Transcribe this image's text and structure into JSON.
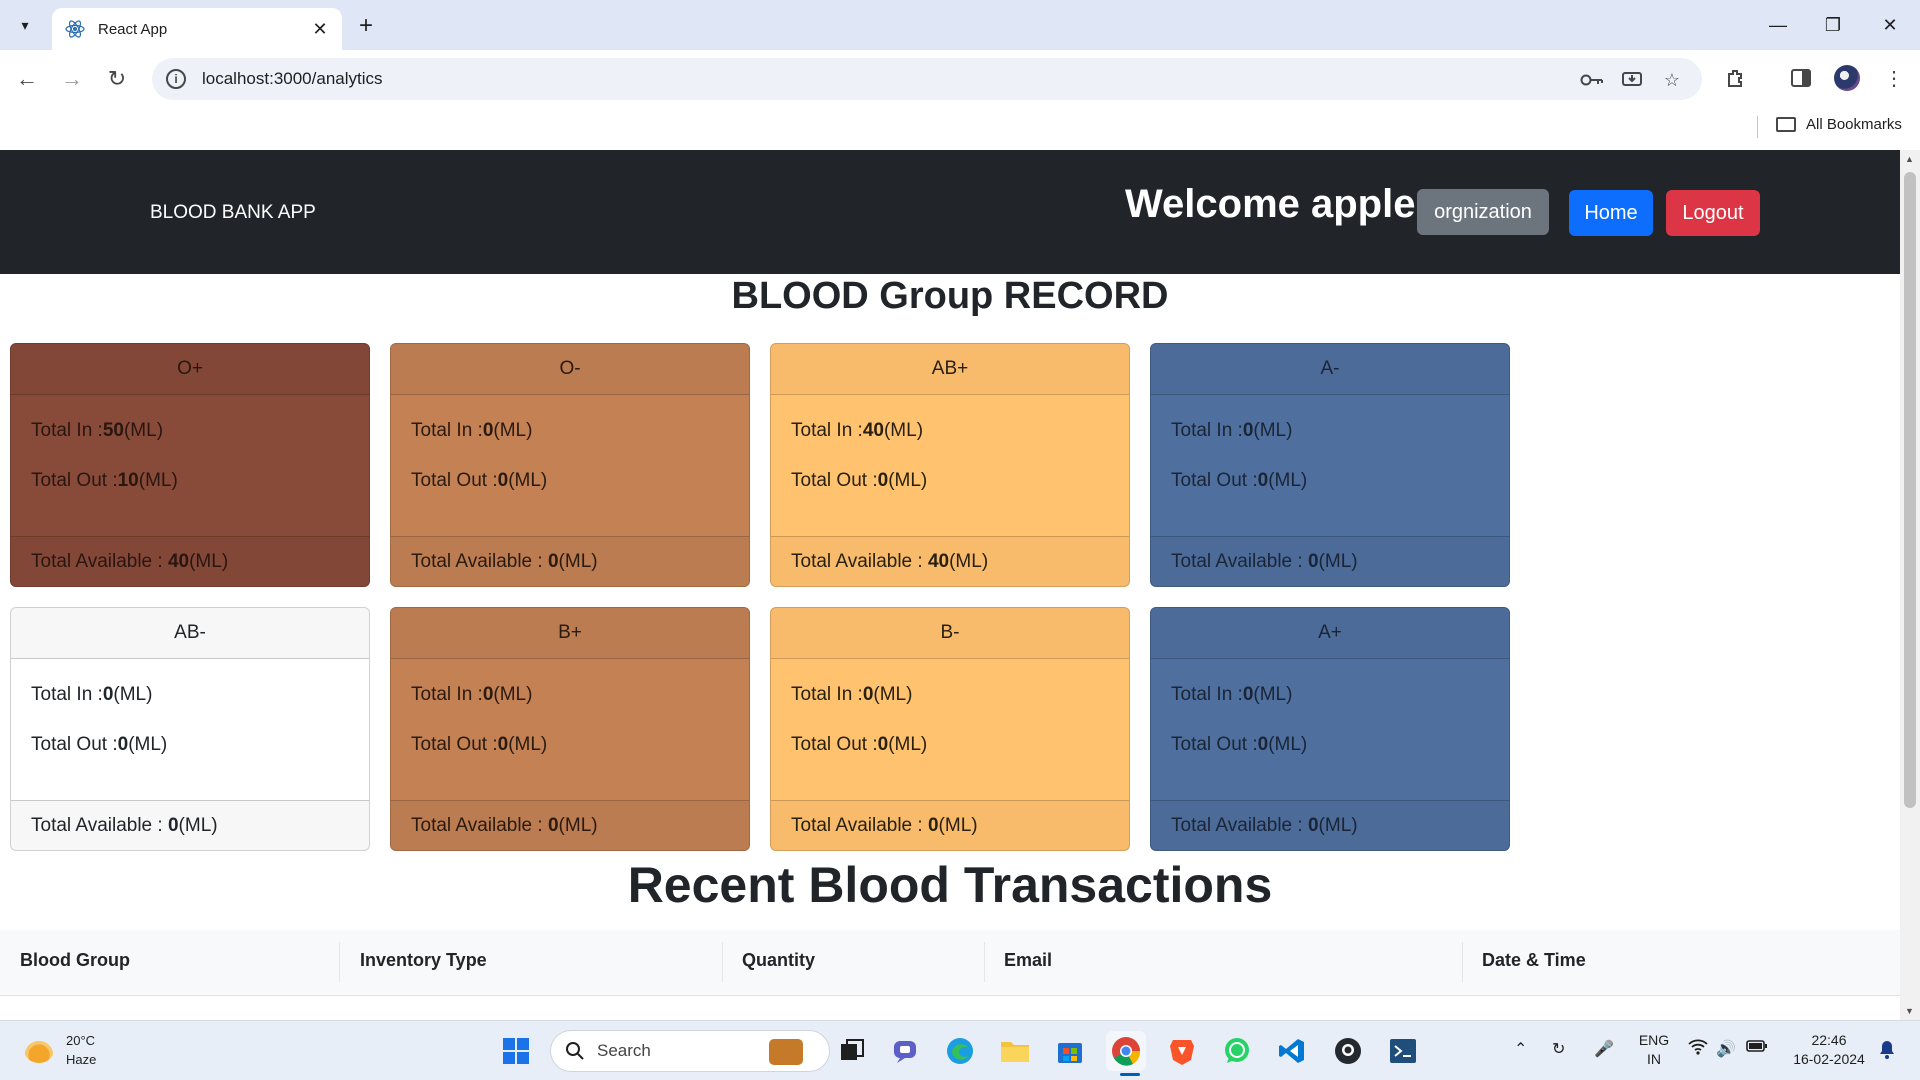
{
  "browser": {
    "tab_title": "React App",
    "url": "localhost:3000/analytics",
    "bookmarks_label": "All Bookmarks"
  },
  "app": {
    "brand": "BLOOD BANK APP",
    "welcome": "Welcome apple",
    "role_label": "orgnization",
    "home_label": "Home",
    "logout_label": "Logout"
  },
  "record_title": "BLOOD Group RECORD",
  "labels": {
    "total_in": "Total In :",
    "total_out": "Total Out :",
    "total_available": "Total Available : ",
    "unit": "(ML)"
  },
  "cards": [
    {
      "group": "O+",
      "in": "50",
      "out": "10",
      "available": "40",
      "bg": "#884a39",
      "text": "#2a1610"
    },
    {
      "group": "O-",
      "in": "0",
      "out": "0",
      "available": "0",
      "bg": "#c38154",
      "text": "#2a1a10"
    },
    {
      "group": "AB+",
      "in": "40",
      "out": "0",
      "available": "40",
      "bg": "#ffc26f",
      "text": "#2a2010"
    },
    {
      "group": "A-",
      "in": "0",
      "out": "0",
      "available": "0",
      "bg": "#4f6f9e",
      "text": "#1a2536"
    },
    {
      "group": "AB-",
      "in": "0",
      "out": "0",
      "available": "0",
      "bg": "#ffffff",
      "text": "#212529"
    },
    {
      "group": "B+",
      "in": "0",
      "out": "0",
      "available": "0",
      "bg": "#c38154",
      "text": "#2a1a10"
    },
    {
      "group": "B-",
      "in": "0",
      "out": "0",
      "available": "0",
      "bg": "#ffc26f",
      "text": "#2a2010"
    },
    {
      "group": "A+",
      "in": "0",
      "out": "0",
      "available": "0",
      "bg": "#4f6f9e",
      "text": "#1a2536"
    }
  ],
  "transactions_title": "Recent Blood Transactions",
  "table": {
    "columns": [
      "Blood Group",
      "Inventory Type",
      "Quantity",
      "Email",
      "Date & Time"
    ]
  },
  "taskbar": {
    "temperature": "20°C",
    "condition": "Haze",
    "search_placeholder": "Search",
    "language": "ENG",
    "region": "IN",
    "time": "22:46",
    "date": "16-02-2024"
  },
  "colors": {
    "navbar": "#212529",
    "home_button": "#0d6efd",
    "logout_button": "#dc3545",
    "role_button": "#6c757d"
  }
}
